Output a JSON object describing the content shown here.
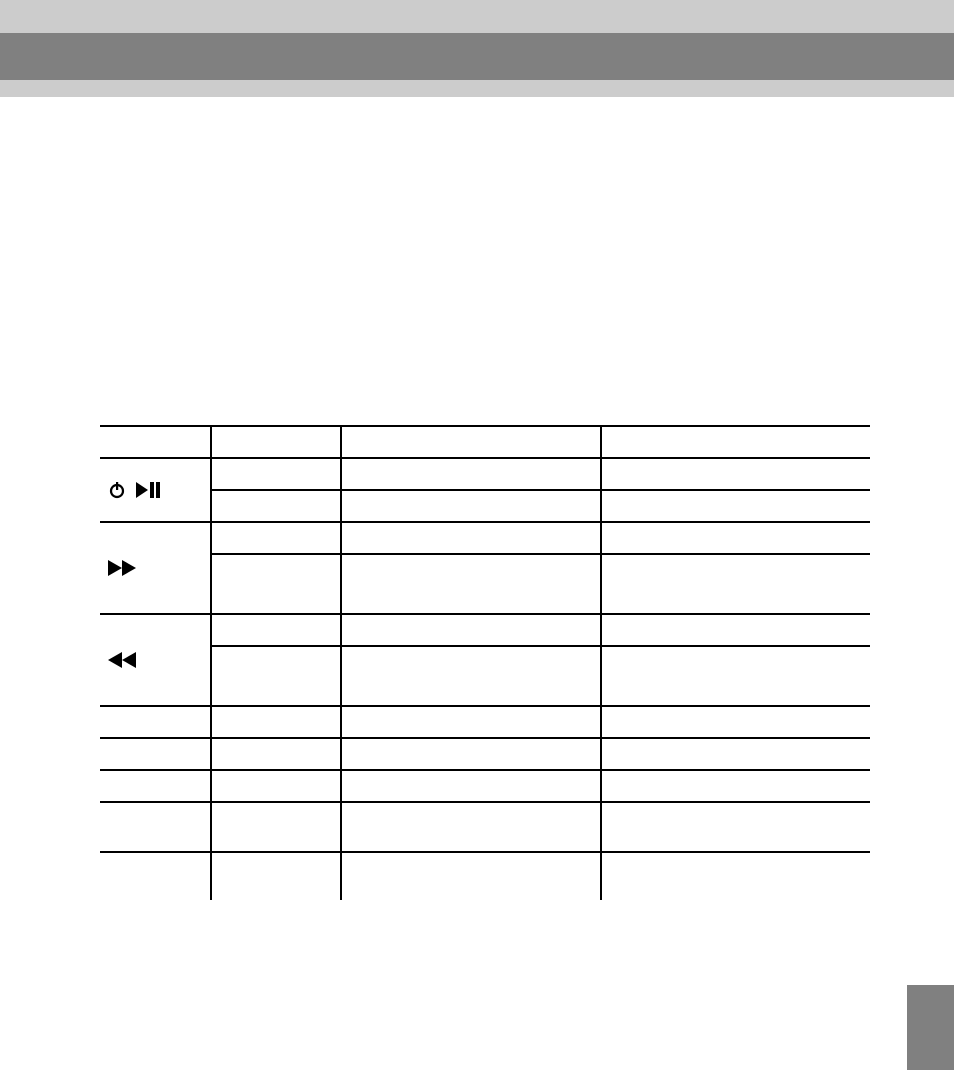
{
  "header": {},
  "table": {
    "head": {
      "button": "",
      "action": "",
      "in_play": "",
      "in_pause": ""
    },
    "rows": [
      {
        "icons": [
          "power",
          "play-pause"
        ],
        "sub": [
          {
            "action": "",
            "in_play": "",
            "in_pause": ""
          },
          {
            "action": "",
            "in_play": "",
            "in_pause": ""
          }
        ]
      },
      {
        "icons": [
          "fast-forward"
        ],
        "sub": [
          {
            "action": "",
            "in_play": "",
            "in_pause": ""
          },
          {
            "action": "",
            "in_play": "",
            "in_pause": ""
          }
        ]
      },
      {
        "icons": [
          "rewind"
        ],
        "sub": [
          {
            "action": "",
            "in_play": "",
            "in_pause": ""
          },
          {
            "action": "",
            "in_play": "",
            "in_pause": ""
          }
        ]
      },
      {
        "button": "",
        "action": "",
        "in_play": "",
        "in_pause": ""
      },
      {
        "button": "",
        "action": "",
        "in_play": "",
        "in_pause": ""
      },
      {
        "button": "",
        "action": "",
        "in_play": "",
        "in_pause": ""
      },
      {
        "button": "",
        "action": "",
        "in_play": "",
        "in_pause": ""
      }
    ]
  },
  "page_number": ""
}
